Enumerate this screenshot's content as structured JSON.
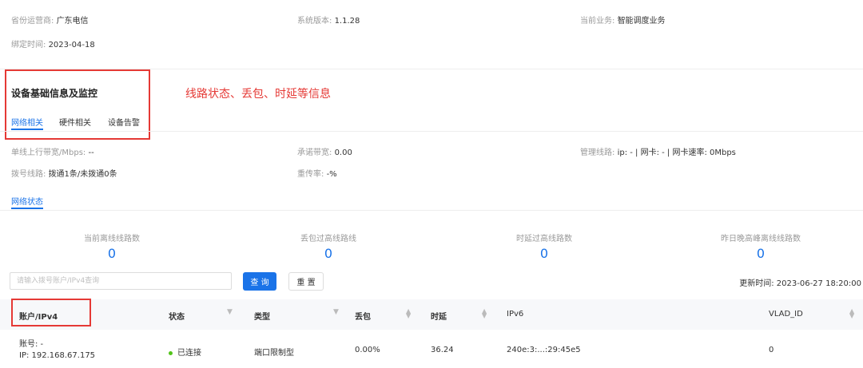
{
  "info": {
    "province_label": "省份运营商:",
    "province_value": "广东电信",
    "version_label": "系统版本:",
    "version_value": "1.1.28",
    "business_label": "当前业务:",
    "business_value": "智能调度业务",
    "bind_label": "绑定时间:",
    "bind_value": "2023-04-18"
  },
  "section": {
    "title": "设备基础信息及监控",
    "annotation": "线路状态、丢包、时延等信息",
    "tabs": [
      "网络相关",
      "硬件相关",
      "设备告警"
    ]
  },
  "network": {
    "uplink_label": "单线上行带宽/Mbps:",
    "uplink_value": "--",
    "commit_label": "承诺带宽:",
    "commit_value": "0.00",
    "mgmt_label": "管理线路:",
    "mgmt_value": "ip: - | 网卡: - | 网卡速率: 0Mbps",
    "dial_label": "拨号线路:",
    "dial_value": "拨通1条/未拨通0条",
    "retrans_label": "重传率:",
    "retrans_value": "-%"
  },
  "status_tab": "网络状态",
  "stats": [
    {
      "label": "当前离线线路数",
      "value": "0"
    },
    {
      "label": "丢包过高线路线",
      "value": "0"
    },
    {
      "label": "时延过高线路数",
      "value": "0"
    },
    {
      "label": "昨日晚高峰离线线路数",
      "value": "0"
    }
  ],
  "search": {
    "placeholder": "请输入拨号账户/IPv4查询",
    "query_label": "查 询",
    "reset_label": "重 置",
    "update_label": "更新时间:",
    "update_value": "2023-06-27 18:20:00"
  },
  "table": {
    "headers": [
      "账户/IPv4",
      "状态",
      "类型",
      "丢包",
      "时延",
      "IPv6",
      "VLAD_ID"
    ],
    "rows": [
      {
        "account": "账号: -",
        "ip": "IP: 192.168.67.175",
        "status": "已连接",
        "type": "端口限制型",
        "loss": "0.00%",
        "latency": "36.24",
        "ipv6": "240e:3:...:29:45e5",
        "vlan": "0"
      }
    ]
  },
  "colors": {
    "accent": "#1a73e8",
    "annotation": "#e53935",
    "status_ok": "#52c41a"
  }
}
